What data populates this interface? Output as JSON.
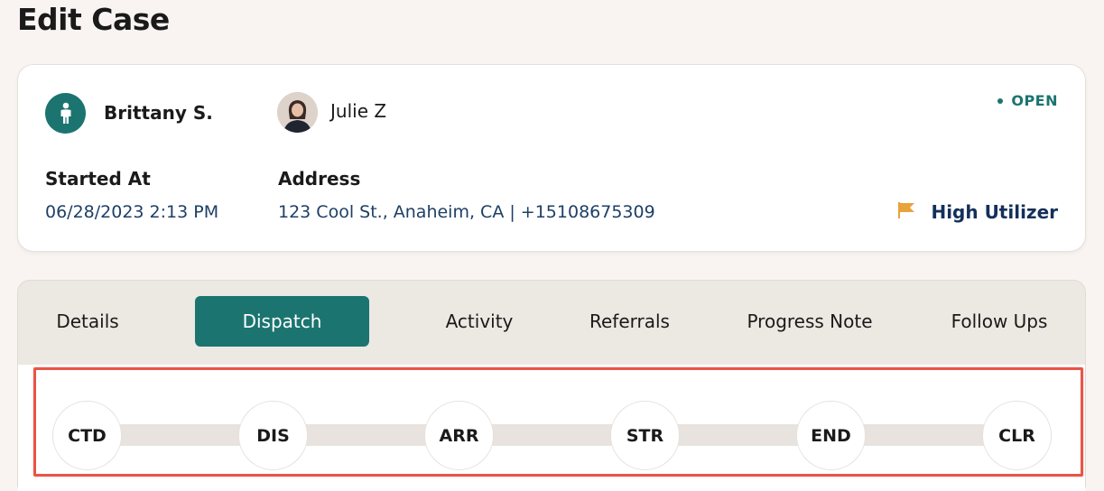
{
  "page": {
    "title": "Edit Case"
  },
  "case": {
    "client_name": "Brittany S.",
    "worker_name": "Julie Z",
    "status": "OPEN",
    "started_at_label": "Started At",
    "started_at_value": "06/28/2023 2:13 PM",
    "address_label": "Address",
    "address_value": "123 Cool St.,  Anaheim,  CA | +15108675309",
    "flag_label": "High Utilizer",
    "colors": {
      "accent": "#1b7470",
      "flag": "#e8a33a",
      "link": "#1e3f66"
    }
  },
  "tabs": [
    {
      "label": "Details"
    },
    {
      "label": "Dispatch",
      "active": true
    },
    {
      "label": "Activity"
    },
    {
      "label": "Referrals"
    },
    {
      "label": "Progress Note"
    },
    {
      "label": "Follow Ups"
    }
  ],
  "dispatch_steps": [
    {
      "label": "CTD"
    },
    {
      "label": "DIS"
    },
    {
      "label": "ARR"
    },
    {
      "label": "STR"
    },
    {
      "label": "END"
    },
    {
      "label": "CLR"
    }
  ],
  "icons": {
    "client": "person-icon",
    "worker": "avatar-photo",
    "flag": "flag-icon"
  }
}
